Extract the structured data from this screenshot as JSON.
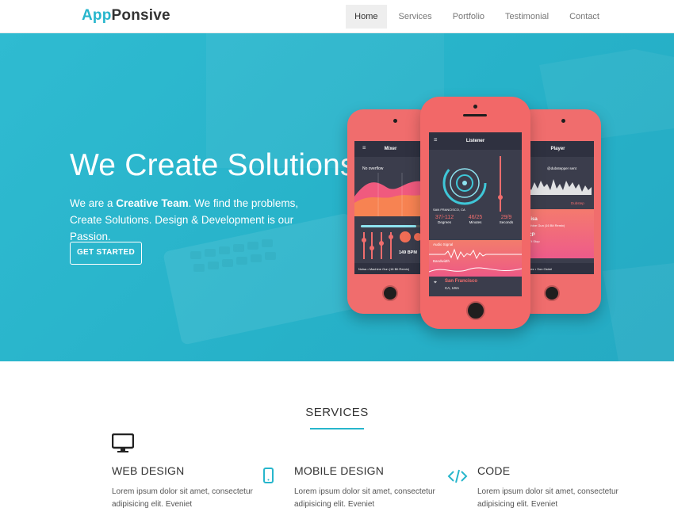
{
  "brand": {
    "part1": "App",
    "part2": "Ponsive"
  },
  "nav": {
    "items": [
      {
        "label": "Home",
        "active": true
      },
      {
        "label": "Services",
        "active": false
      },
      {
        "label": "Portfolio",
        "active": false
      },
      {
        "label": "Testimonial",
        "active": false
      },
      {
        "label": "Contact",
        "active": false
      }
    ]
  },
  "hero": {
    "title": "We Create Solutions",
    "desc_prefix": "We are a ",
    "desc_bold": "Creative Team",
    "desc_suffix": ". We find the problems, Create Solutions. Design & Development is our Passion.",
    "cta": "GET STARTED"
  },
  "phones": {
    "left": {
      "title": "Mixer",
      "note": "No overflow",
      "bpm": "149 BPM",
      "footer": "Noisa • Machine Gun (16 Bit Remix)"
    },
    "center": {
      "title": "Listener",
      "location_label": "SAN FRANCISCO, CA",
      "stats": [
        {
          "value": "37/-112",
          "label": "Degrees"
        },
        {
          "value": "46/25",
          "label": "Minutes"
        },
        {
          "value": "29/9",
          "label": "Seconds"
        }
      ],
      "signal_label": "Audio Signal",
      "bandwidth_label": "Bandwidth",
      "city": "San Francisco",
      "state": "CA, USA"
    },
    "right": {
      "title": "Player",
      "handle": "@dubstepper sent",
      "track1": "noisa",
      "track1b": "Machine Gun (16 Bit Remix)",
      "track2": "HCP",
      "track2b": "Don't Stop",
      "tag": "Dubstep",
      "footer": "Tabez • Son Ostrel"
    }
  },
  "services": {
    "title": "SERVICES",
    "items": [
      {
        "title": "WEB DESIGN",
        "icon": "monitor-icon",
        "text": "Lorem ipsum dolor sit amet, consectetur adipisicing elit. Eveniet"
      },
      {
        "title": "MOBILE DESIGN",
        "icon": "mobile-icon",
        "text": "Lorem ipsum dolor sit amet, consectetur adipisicing elit. Eveniet"
      },
      {
        "title": "CODE",
        "icon": "code-icon",
        "text": "Lorem ipsum dolor sit amet, consectetur adipisicing elit. Eveniet"
      }
    ]
  },
  "colors": {
    "accent": "#27b6cc",
    "hero_bg": "#2bb5cc",
    "phone_body": "#f06d6d"
  }
}
